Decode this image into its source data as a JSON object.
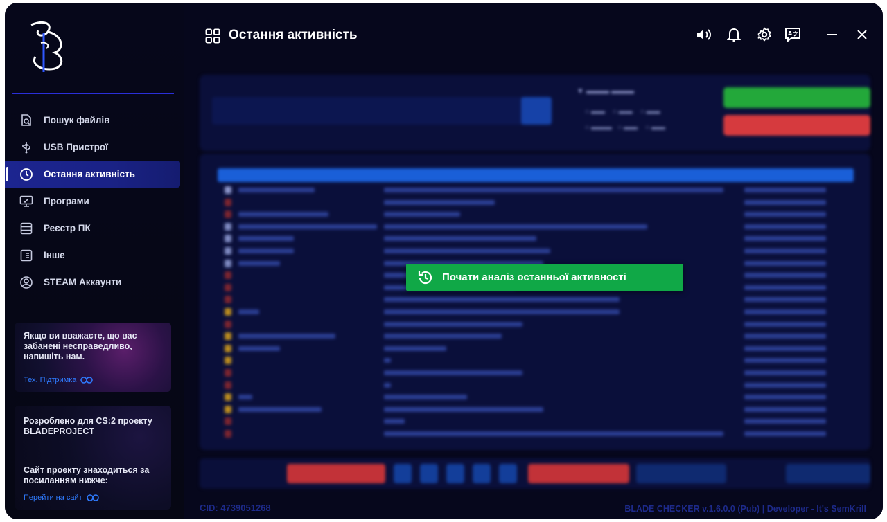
{
  "window": {
    "title": "Остання активність"
  },
  "sidebar": {
    "items": [
      {
        "label": "Пошук файлів",
        "icon": "file-search-icon"
      },
      {
        "label": "USB Пристрої",
        "icon": "usb-icon"
      },
      {
        "label": "Остання активність",
        "icon": "clock-icon",
        "active": true
      },
      {
        "label": "Програми",
        "icon": "monitor-icon"
      },
      {
        "label": "Реєстр ПК",
        "icon": "database-icon"
      },
      {
        "label": "Інше",
        "icon": "list-icon"
      },
      {
        "label": "STEAM Аккаунти",
        "icon": "user-circle-icon"
      }
    ],
    "ban_card": {
      "text": "Якщо ви вважаєте, що вас забанені несправедливо, напишіть нам.",
      "link": "Тех. Підтримка"
    },
    "project_card": {
      "line1": "Розроблено для CS:2 проекту BLADEPROJECT",
      "line2": "Сайт проекту знаходиться за посиланням нижче:",
      "link": "Перейти на сайт"
    }
  },
  "main": {
    "start_button": "Почати аналіз останньої активності"
  },
  "footer": {
    "cid": "CID: 4739051268",
    "version": "BLADE CHECKER v.1.6.0.0 (Pub) | Developer - It's SemKrill"
  },
  "colors": {
    "accent": "#1c2590",
    "start_green": "#10a847",
    "footer_text": "#1d2a8a"
  }
}
